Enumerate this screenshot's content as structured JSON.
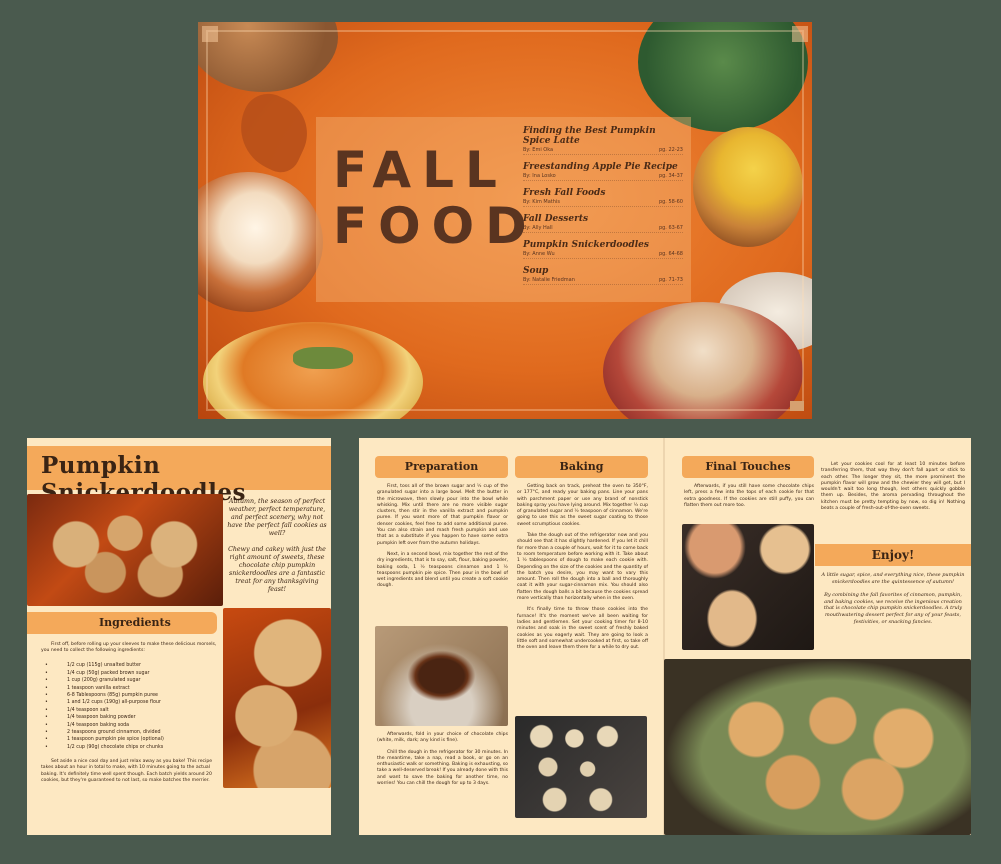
{
  "cover": {
    "title_line1": "FALL",
    "title_line2": "FOOD",
    "toc": [
      {
        "title": "Finding the Best Pumpkin Spice Latte",
        "byline": "By: Emi Oka",
        "pages": "pg. 22-23"
      },
      {
        "title": "Freestanding Apple Pie Recipe",
        "byline": "By: Ina Losko",
        "pages": "pg. 34-37"
      },
      {
        "title": "Fresh Fall Foods",
        "byline": "By: Kim Mathis",
        "pages": "pg. 58-60"
      },
      {
        "title": "Fall Desserts",
        "byline": "By: Ally Hall",
        "pages": "pg. 63-67"
      },
      {
        "title": "Pumpkin Snickerdoodles",
        "byline": "By: Anne Wu",
        "pages": "pg. 64-68"
      },
      {
        "title": "Soup",
        "byline": "By: Natalie Friedman",
        "pages": "pg. 71-73"
      }
    ]
  },
  "left_page": {
    "title": "Pumpkin Snickerdoodles",
    "intro_p1": "Autumn, the season of perfect weather, perfect temperature, and perfect scenery, why not have the perfect fall cookies as well?",
    "intro_p2": "Chewy and cakey with just the right amount of sweets, these chocolate chip pumpkin snickerdoodles are a fantastic treat for any thanksgiving feast!",
    "ingredients_heading": "Ingredients",
    "ingredients_intro": "First off, before rolling up your sleeves to make these delicious morsels, you need to collect the following ingredients:",
    "ingredients": [
      "1/2 cup (115g) unsalted butter",
      "1/4 cup (50g) packed brown sugar",
      "1 cup (200g) granulated sugar",
      "1 teaspoon vanilla extract",
      "6-8 Tablespoons (85g) pumpkin puree",
      "1 and 1/2 cups (190g) all-purpose flour",
      "1/4 teaspoon salt",
      "1/4 teaspoon baking powder",
      "1/4 teaspoon baking soda",
      "2 teaspoons ground cinnamon, divided",
      "1 teaspoon pumpkin pie spice (optional)",
      "1/2 cup (90g) chocolate chips or chunks"
    ],
    "ingredients_outro": "Set aside a nice cool day and just relax away as you bake! This recipe takes about an hour in total to make, with 10 minutes going to the actual baking.  It's definitely time well spent though. Each batch yields around 20 cookies, but they're guaranteed to not last, so make batches the merrier."
  },
  "spread": {
    "preparation_heading": "Preparation",
    "preparation_p1": "First, toss all of the brown sugar and ½ cup of the granulated sugar into a large bowl. Melt the butter in the microwave, then slowly pour into the bowl while whisking. Mix until there are no more visible sugar clusters, then stir in the vanilla extract and pumpkin puree. If you want more of that pumpkin flavor or denser cookies, feel free to add some additional puree. You can also strain and mash fresh pumpkin and use that as a substitute if you happen to have some extra pumpkin left over from the autumn holidays.",
    "preparation_p2": "Next, in a second bowl, mix together the rest of the dry ingredients, that is to say, salt, flour, baking powder, baking soda, 1 ½ teaspoons cinnamon and 1 ½ teaspoons pumpkin pie spice. Then pour in the bowl of wet ingredients and blend until you create a soft cookie dough.",
    "preparation_p3": "Afterwards, fold in your choice of chocolate chips (white, milk, dark; any kind is fine).",
    "preparation_p4": "Chill the dough in the refrigerator for 30 minutes. In the meantime, take a nap, read a book, or go on an enthusiastic walk or something. Baking is exhausting, so take a well-deserved break! If you already done with this and want to save the baking for another time, no worries! You can chill the dough for up to 3 days.",
    "baking_heading": "Baking",
    "baking_p1": "Getting back on track, preheat the oven to 350°F, or 177°C, and ready your baking pans. Line your pans with parchment paper or use any brand of nonstick baking spray you have lying around. Mix together ½ cup of granulated sugar and ½ teaspoon of cinnamon. We're going to use this as the sweet sugar coating to those sweet scrumptious cookies.",
    "baking_p2": "Take the dough out of the refrigerator now and you should see that it has slightly hardened. If you let it chill for more than a couple of hours, wait for it to come back to room temperature before working with it. Take about 1 ½ tablespoons of dough to make each cookie with. Depending on the size of the cookies and the quantity of the batch you desire, you may want to vary this amount. Then roll the dough into a ball and thoroughly coat it with your sugar-cinnamon mix. You should also flatten the dough balls a bit because the cookies spread more vertically than horizontally when in the oven.",
    "baking_p3": "It's finally time to throw those cookies into the furnace! It's the moment we've all been waiting for ladies and gentlemen. Set your cooking timer for 8-10 minutes and soak in the sweet scent of freshly baked cookies as you eagerly wait. They are going to look a little soft and somewhat undercooked at first, so take off the oven and leave them there for a while to dry out.",
    "final_heading": "Final Touches",
    "final_p1": "Afterwards, if you still have some chocolate chips left, press a few into the tops of each cookie for that extra goodness. If the cookies are still puffy, you can flatten them out more too.",
    "final_p2": "Let your cookies cool for at least 10 minutes before transferring them, that way they don't fall apart or stick to each other. The longer they sit, the more prominent the pumpkin flavor will grow and the chewier they will get, but I wouldn't wait too long though, lest others quickly gobble them up. Besides, the aroma pervading throughout the kitchen must be pretty tempting by now, so dig in! Nothing beats a couple of fresh-out-of-the-oven sweets.",
    "enjoy_heading": "Enjoy!",
    "enjoy_p1": "A little sugar, spice, and everything nice, these pumpkin snickerdoodles are the quintessence of autumn!",
    "enjoy_p2": "By combining the fall favorites of cinnamon, pumpkin, and baking cookies, we receive the ingenious creation that is chocolate chip pumpkin snickerdoodles. A truly mouthwatering dessert perfect for any of your feasts, festivities, or snacking fancies."
  }
}
